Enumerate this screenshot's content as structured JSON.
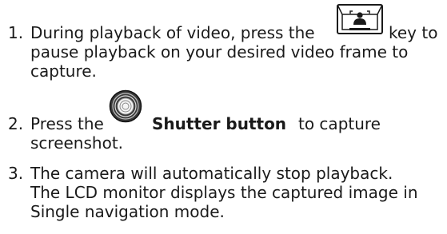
{
  "steps": [
    {
      "number": "1.",
      "line1_before": "During playback of video, press the",
      "key_icon": "capture-key-icon",
      "line1_after": "key to",
      "line2": "pause playback on your desired video frame to",
      "line3": "capture."
    },
    {
      "number": "2.",
      "line1_before": "Press the",
      "button_icon": "shutter-button-icon",
      "line1_bold": "Shutter button",
      "line1_after": "to capture",
      "line2": "screenshot."
    },
    {
      "number": "3.",
      "line1": "The camera will automatically stop playback.",
      "line2": "The LCD monitor displays the captured image in",
      "line3": "Single navigation mode."
    }
  ]
}
